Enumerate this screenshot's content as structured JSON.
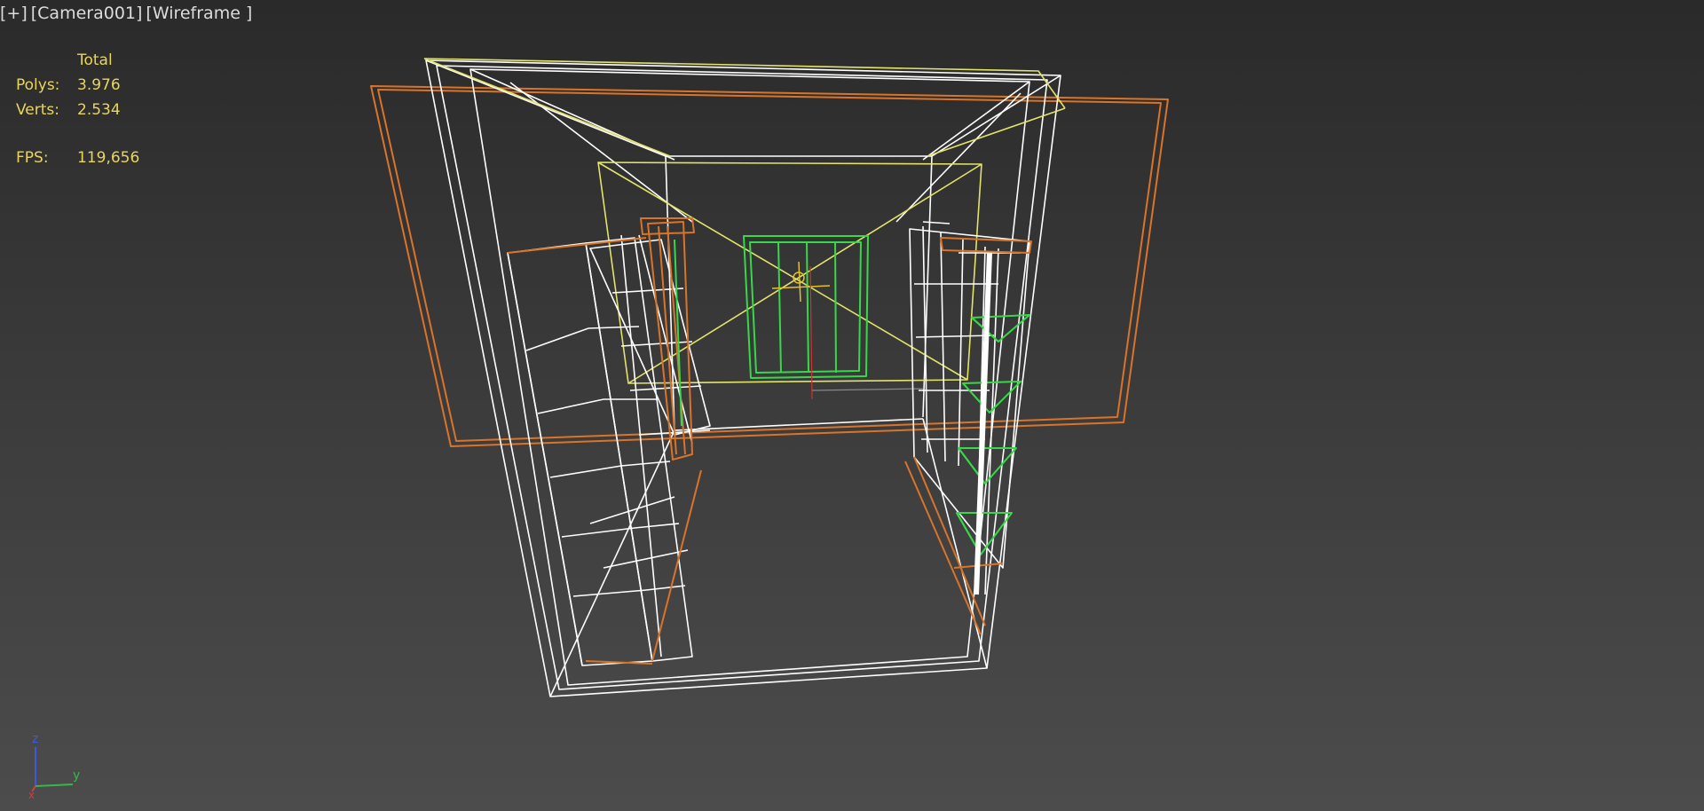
{
  "viewport": {
    "label": {
      "plus": "[+]",
      "camera": "[Camera001]",
      "mode": "[Wireframe ]"
    },
    "stats": {
      "header": "Total",
      "polys_label": "Polys:",
      "polys_value": "3.976",
      "verts_label": "Verts:",
      "verts_value": "2.534",
      "fps_label": "FPS:",
      "fps_value": "119,656"
    },
    "axis": {
      "z": "z",
      "y": "y",
      "x": "x"
    }
  },
  "colors": {
    "background_top": "#2a2a2a",
    "background_bottom": "#4c4c4c",
    "stats_text": "#e8d65a",
    "wire_white": "#ffffff",
    "wire_orange": "#d9742a",
    "wire_yellow": "#e3e36a",
    "wire_green": "#37d84a"
  }
}
